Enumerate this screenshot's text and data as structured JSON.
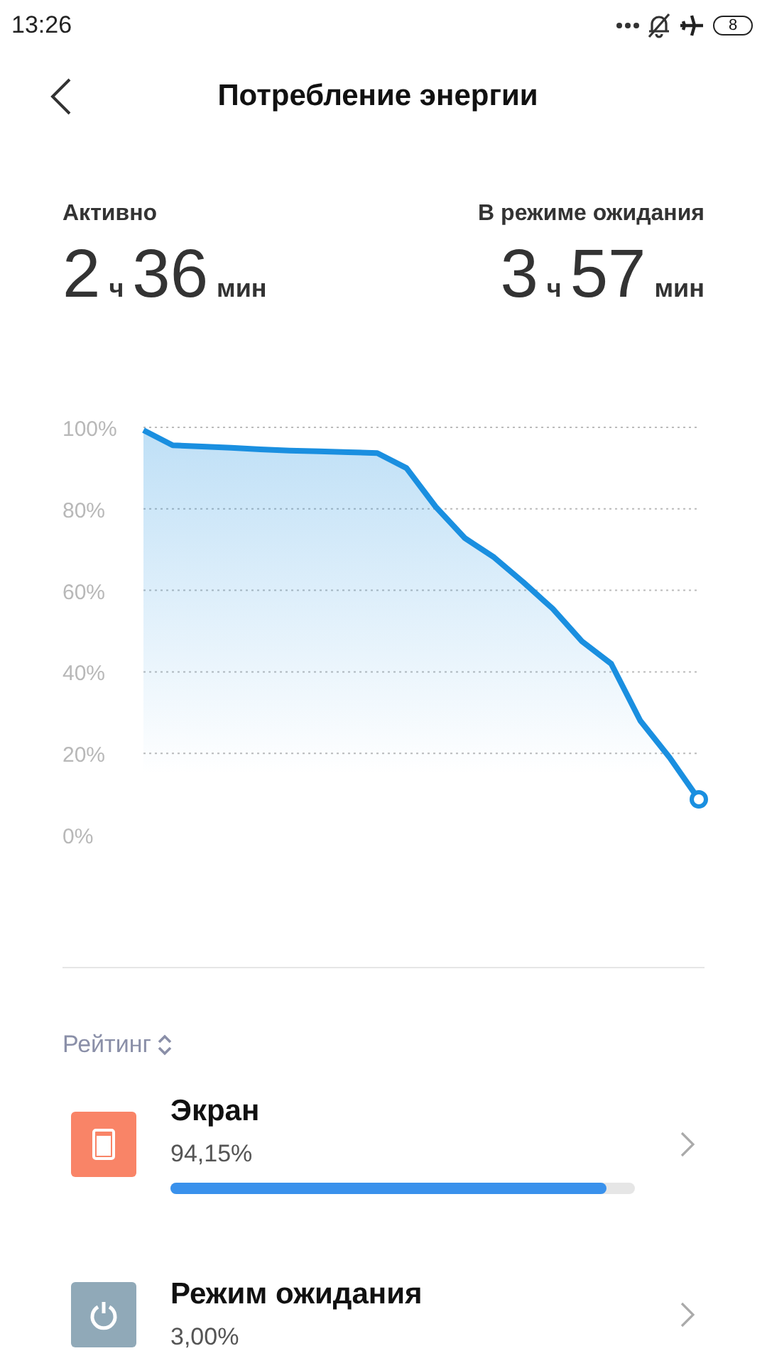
{
  "status_bar": {
    "time": "13:26",
    "battery": "8"
  },
  "header": {
    "title": "Потребление энергии"
  },
  "summary": [
    {
      "label": "Активно",
      "hours": "2",
      "hours_unit": "ч",
      "minutes": "36",
      "minutes_unit": "мин"
    },
    {
      "label": "В режиме ожидания",
      "hours": "3",
      "hours_unit": "ч",
      "minutes": "57",
      "minutes_unit": "мин"
    }
  ],
  "chart_data": {
    "type": "area",
    "ylim": [
      0,
      100
    ],
    "yticks": [
      {
        "value": 0,
        "label": "0%"
      },
      {
        "value": 20,
        "label": "20%"
      },
      {
        "value": 40,
        "label": "40%"
      },
      {
        "value": 60,
        "label": "60%"
      },
      {
        "value": 80,
        "label": "80%"
      },
      {
        "value": 100,
        "label": "100%"
      }
    ],
    "grid": true,
    "series": [
      {
        "color": "#1a8fe0",
        "values": [
          99.3,
          95.6,
          95.3,
          95,
          94.6,
          94.3,
          94.1,
          93.9,
          93.7,
          90,
          80.5,
          72.8,
          68.1,
          62,
          55.5,
          47.5,
          42,
          28,
          19,
          8.7
        ]
      }
    ]
  },
  "sort": {
    "label": "Рейтинг"
  },
  "items": [
    {
      "kind": "screen",
      "name": "Экран",
      "percent": "94,15%",
      "level": 0.94,
      "color": "#f98467"
    },
    {
      "kind": "standby",
      "name": "Режим ожидания",
      "percent": "3,00%",
      "color": "#90a9b8"
    }
  ]
}
